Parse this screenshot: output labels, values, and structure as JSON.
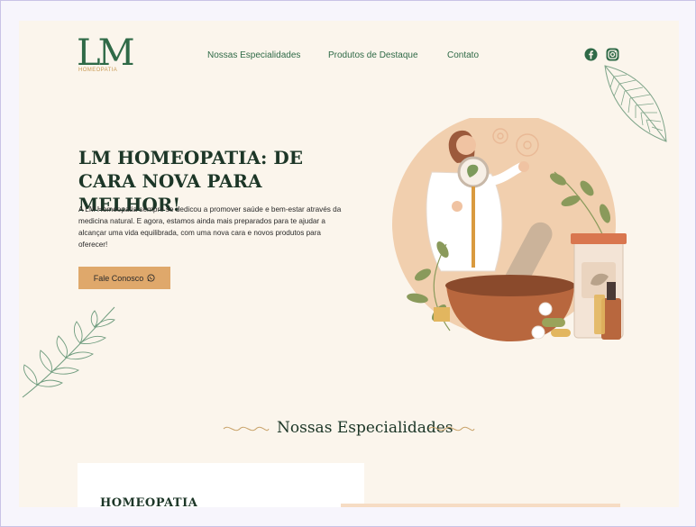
{
  "brand": {
    "logo_mark": "LM",
    "logo_sub": "HOMEOPATIA"
  },
  "nav": {
    "items": [
      "Nossas Especialidades",
      "Produtos de Destaque",
      "Contato"
    ]
  },
  "social": {
    "icons": [
      "facebook-icon",
      "instagram-icon"
    ]
  },
  "hero": {
    "title": "LM HOMEOPATIA: DE CARA NOVA PARA MELHOR!",
    "text": "A LM Homeopatia sempre se dedicou a promover saúde e bem-estar através da medicina natural. E agora, estamos ainda mais preparados para te ajudar a alcançar uma vida equilibrada, com uma nova cara e novos produtos para oferecer!",
    "cta_label": "Fale Conosco",
    "cta_icon": "whatsapp-icon"
  },
  "specialties": {
    "heading": "Nossas Especialidades",
    "card_title": "HOMEOPATIA"
  },
  "colors": {
    "primary_green": "#2f6a47",
    "dark_green": "#1c3627",
    "accent_orange": "#dfa86b",
    "background": "#fbf5ec"
  }
}
